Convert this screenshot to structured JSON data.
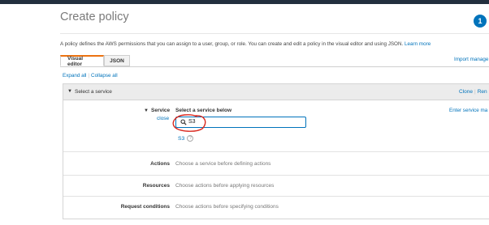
{
  "header": {
    "title": "Create policy",
    "step_badge": "1"
  },
  "intro": {
    "text": "A policy defines the AWS permissions that you can assign to a user, group, or role. You can create and edit a policy in the visual editor and using JSON.",
    "learn_more": "Learn more"
  },
  "tabs": [
    {
      "label": "Visual editor",
      "active": true
    },
    {
      "label": "JSON",
      "active": false
    }
  ],
  "import_link": "Import manage",
  "toolbar": {
    "expand_all": "Expand all",
    "collapse_all": "Collapse all"
  },
  "service_panel": {
    "title": "Select a service",
    "clone": "Clone",
    "remove_partial": "Ren",
    "service_label": "Service",
    "close": "close",
    "select_heading": "Select a service below",
    "enter_manually": "Enter service ma",
    "search": {
      "value": "S3"
    },
    "results": [
      {
        "label": "S3"
      }
    ],
    "rows": [
      {
        "label": "Actions",
        "desc": "Choose a service before defining actions"
      },
      {
        "label": "Resources",
        "desc": "Choose actions before applying resources"
      },
      {
        "label": "Request conditions",
        "desc": "Choose actions before specifying conditions"
      }
    ]
  },
  "colors": {
    "link": "#0073bb",
    "tab_accent": "#ec7211",
    "annotation": "#d9261c",
    "topbar": "#232f3e"
  },
  "icons": [
    "caret-down-icon",
    "search-icon",
    "info-icon"
  ]
}
